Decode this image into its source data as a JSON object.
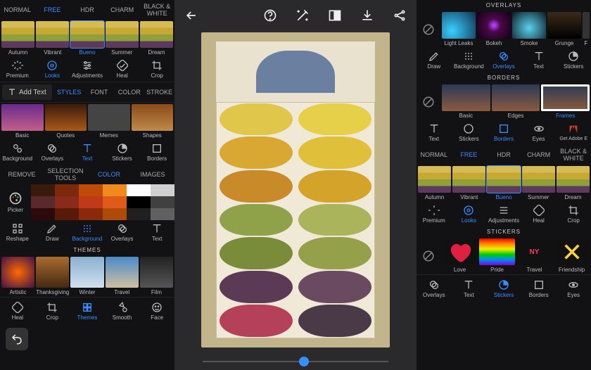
{
  "left": {
    "top_tabs": [
      "NORMAL",
      "FREE",
      "HDR",
      "CHARM",
      "BLACK & WHITE"
    ],
    "top_tabs_active": 1,
    "looks": [
      "Autumn",
      "Vibrant",
      "Bueno",
      "Summer",
      "Dream"
    ],
    "looks_active": 2,
    "main_tools": [
      "Premium",
      "Looks",
      "Adjustments",
      "Heal",
      "Crop"
    ],
    "main_tools_active": 1,
    "addtext": "Add Text",
    "text_tabs": [
      "STYLES",
      "FONT",
      "COLOR",
      "STROKE"
    ],
    "text_tabs_active": 0,
    "text_styles": [
      "Basic",
      "Quotes",
      "Memes",
      "Shapes"
    ],
    "layer_tools": [
      "Background",
      "Overlays",
      "Text",
      "Stickers",
      "Borders"
    ],
    "layer_tools_active": 2,
    "color_tabs": [
      "REMOVE",
      "SELECTION TOOLS",
      "COLOR",
      "IMAGES"
    ],
    "color_tabs_active": 2,
    "picker": "Picker",
    "swatches": [
      "#3a1a0a",
      "#7a2a0a",
      "#c04a0a",
      "#f08a1a",
      "#ffffff",
      "#d0d0d0",
      "#5a2a2a",
      "#8a2a1a",
      "#c03a1a",
      "#e05a1a",
      "#000000",
      "#404040",
      "#2a0a0a",
      "#5a1a0a",
      "#8a2a0a",
      "#b04a0a",
      "#202020",
      "#606060"
    ],
    "bg_tools": [
      "Reshape",
      "Draw",
      "Background",
      "Overlays",
      "Text"
    ],
    "bg_tools_active": 2,
    "themes_title": "THEMES",
    "themes": [
      "Artistic",
      "Thanksgiving",
      "Winter",
      "Travel",
      "Film"
    ],
    "bottom_tools": [
      "Heal",
      "Crop",
      "Themes",
      "Smooth",
      "Face"
    ],
    "bottom_tools_active": 2
  },
  "mid": {
    "slider_pct": 52
  },
  "right": {
    "overlays_title": "OVERLAYS",
    "overlays": [
      "Light Leaks",
      "Bokeh",
      "Smoke",
      "Grunge",
      "F"
    ],
    "overlay_tools": [
      "Draw",
      "Background",
      "Overlays",
      "Text",
      "Stickers"
    ],
    "overlay_tools_active": 2,
    "borders_title": "BORDERS",
    "borders": [
      "Basic",
      "Edges",
      "Frames"
    ],
    "borders_active": 2,
    "border_tools": [
      "Text",
      "Stickers",
      "Borders",
      "Eyes",
      "Get Adobe E"
    ],
    "border_tools_active": 2,
    "top_tabs": [
      "NORMAL",
      "FREE",
      "HDR",
      "CHARM",
      "BLACK & WHITE"
    ],
    "top_tabs_active": 1,
    "looks": [
      "Autumn",
      "Vibrant",
      "Bueno",
      "Summer",
      "Dream"
    ],
    "looks_active": 2,
    "main_tools": [
      "Premium",
      "Looks",
      "Adjustments",
      "Heal",
      "Crop"
    ],
    "main_tools_active": 1,
    "stickers_title": "STICKERS",
    "stickers": [
      "Love",
      "Pride",
      "Travel",
      "Friendship"
    ],
    "bottom_tools": [
      "Overlays",
      "Text",
      "Stickers",
      "Borders",
      "Eyes"
    ],
    "bottom_tools_active": 2
  }
}
